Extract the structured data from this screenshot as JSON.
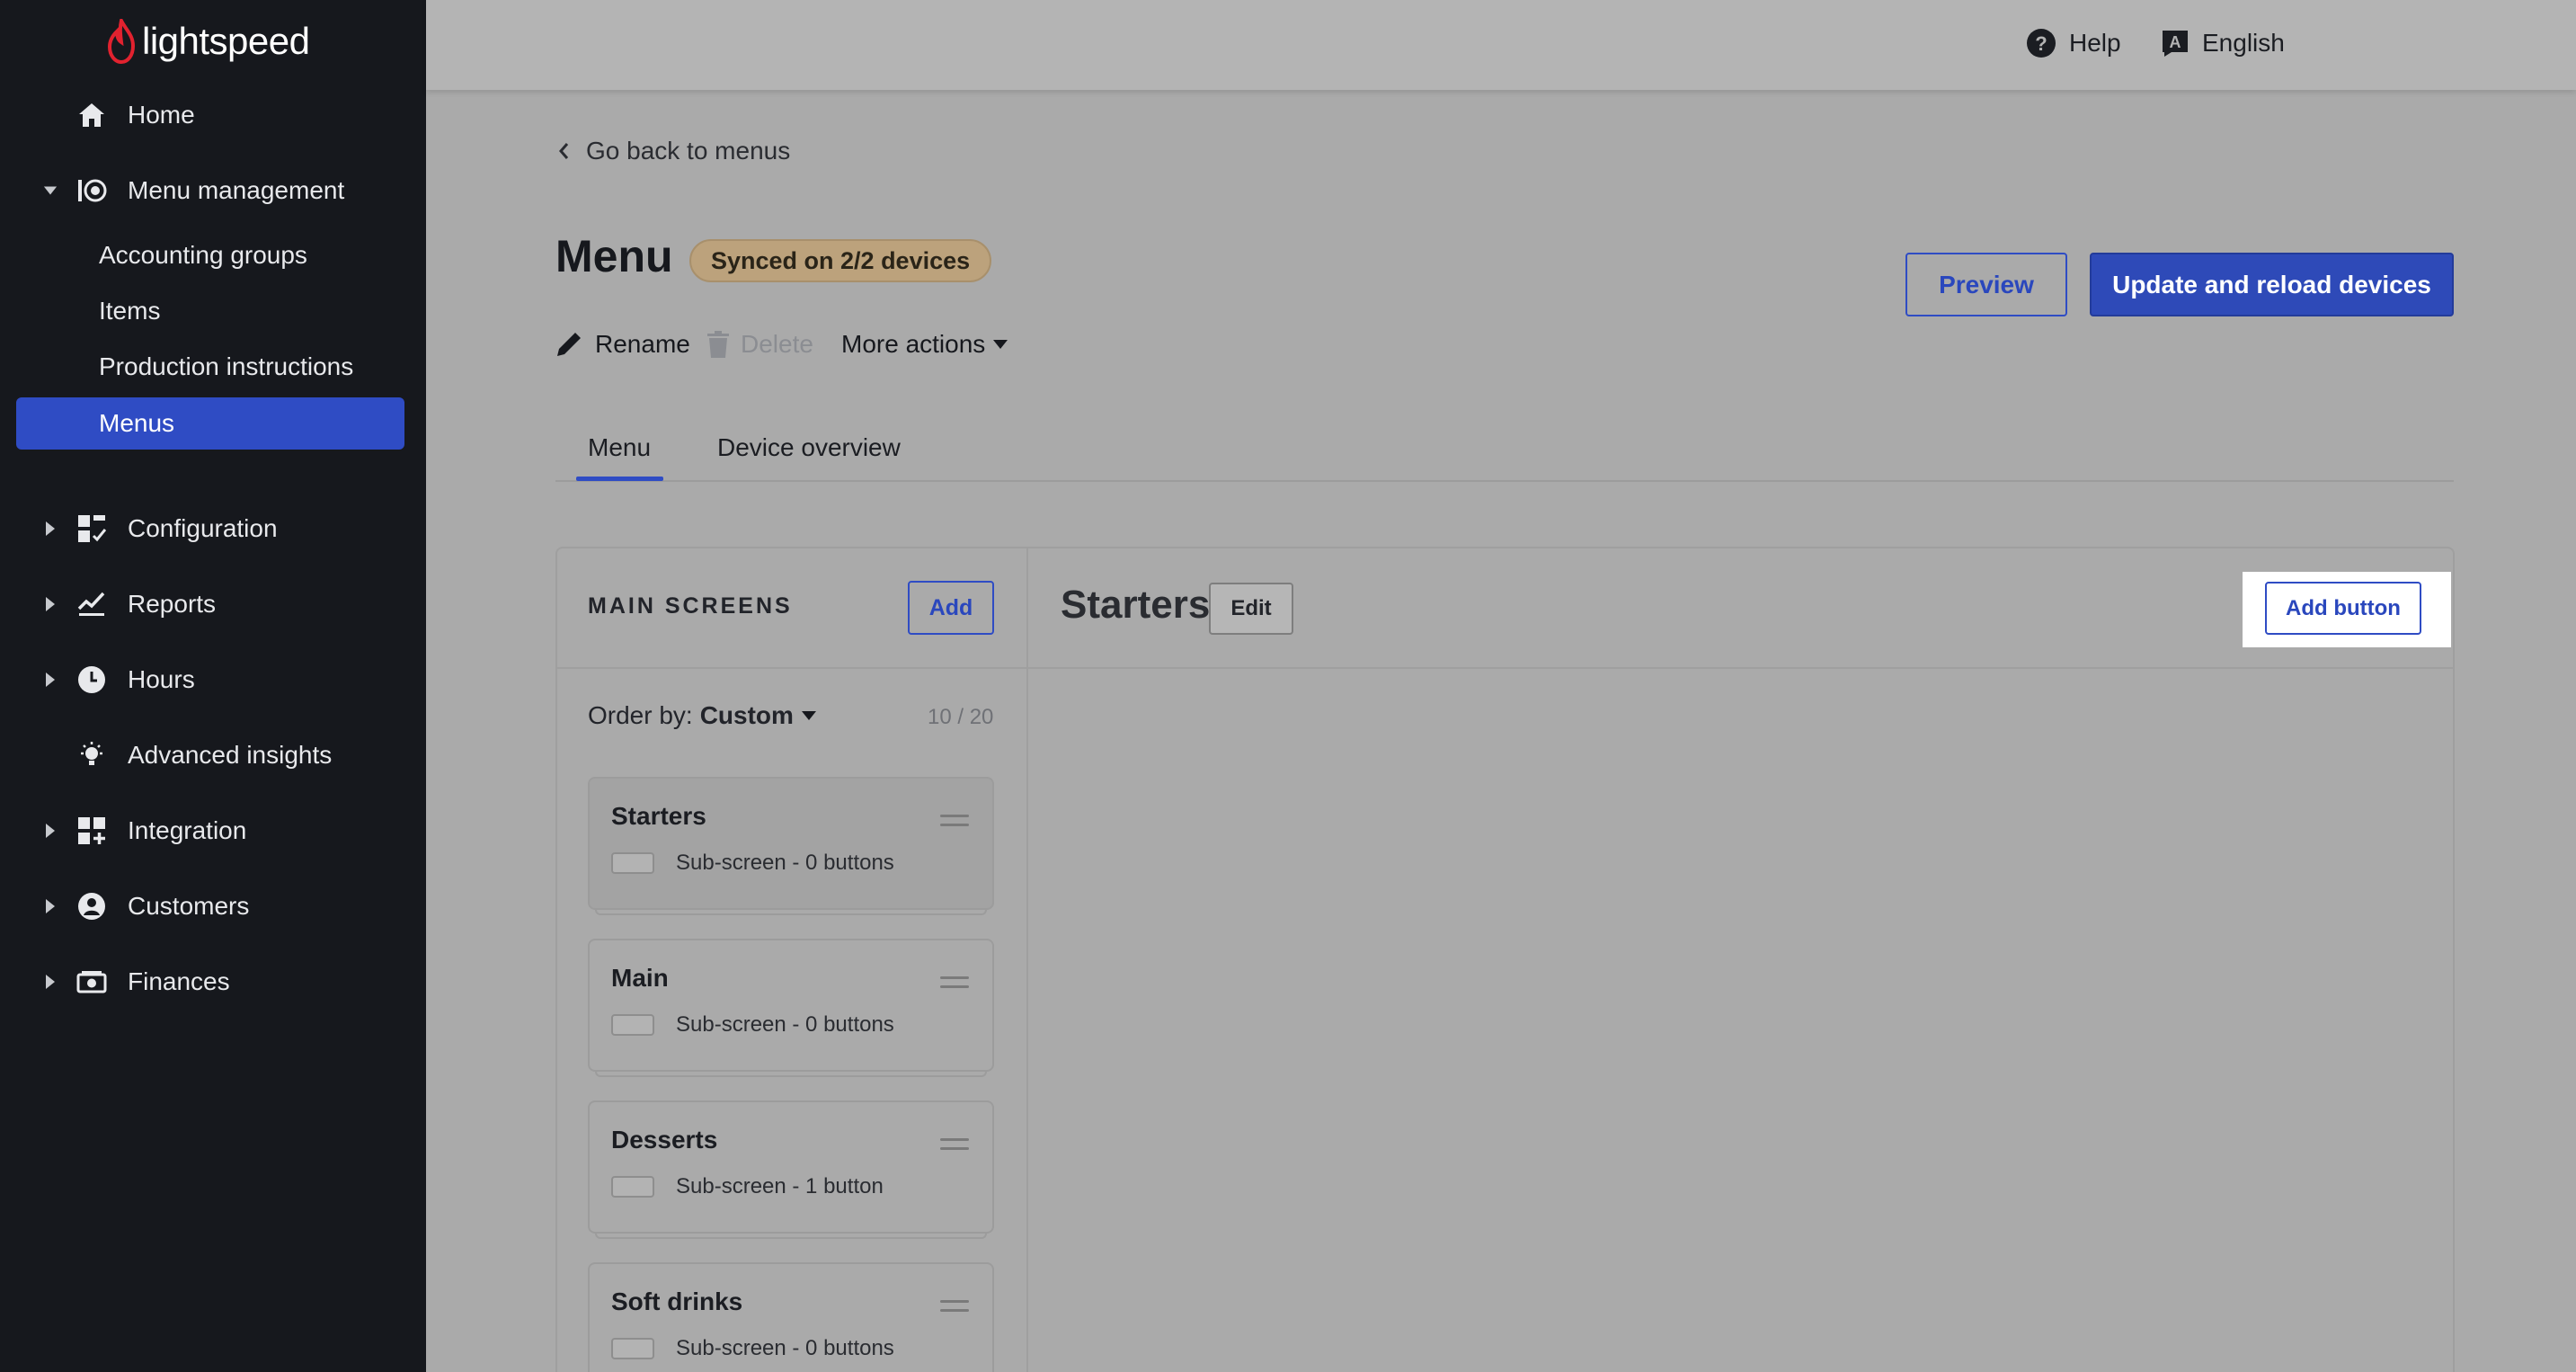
{
  "brand": {
    "name": "lightspeed"
  },
  "sidebar": {
    "items": [
      {
        "label": "Home",
        "icon": "home-icon"
      },
      {
        "label": "Menu management",
        "icon": "menu-management-icon"
      },
      {
        "label": "Configuration",
        "icon": "configuration-icon"
      },
      {
        "label": "Reports",
        "icon": "reports-icon"
      },
      {
        "label": "Hours",
        "icon": "clock-icon"
      },
      {
        "label": "Advanced insights",
        "icon": "lightbulb-icon"
      },
      {
        "label": "Integration",
        "icon": "integration-icon"
      },
      {
        "label": "Customers",
        "icon": "user-icon"
      },
      {
        "label": "Finances",
        "icon": "finances-icon"
      }
    ],
    "sub_items": [
      {
        "label": "Accounting groups"
      },
      {
        "label": "Items"
      },
      {
        "label": "Production instructions"
      },
      {
        "label": "Menus",
        "active": true
      }
    ]
  },
  "topbar": {
    "help": "Help",
    "language": "English"
  },
  "header": {
    "back_link": "Go back to menus",
    "title": "Menu",
    "sync_badge": "Synced on 2/2 devices",
    "preview_button": "Preview",
    "update_button": "Update and reload devices",
    "actions": {
      "rename": "Rename",
      "delete": "Delete",
      "more": "More actions"
    }
  },
  "tabs": [
    {
      "label": "Menu",
      "active": true
    },
    {
      "label": "Device overview"
    }
  ],
  "main_screens": {
    "heading": "MAIN SCREENS",
    "add_button": "Add",
    "order_by_label": "Order by:",
    "order_by_value": "Custom",
    "count": "10 / 20",
    "screens": [
      {
        "title": "Starters",
        "subtitle": "Sub-screen - 0 buttons",
        "selected": true
      },
      {
        "title": "Main",
        "subtitle": "Sub-screen - 0 buttons"
      },
      {
        "title": "Desserts",
        "subtitle": "Sub-screen - 1 button"
      },
      {
        "title": "Soft drinks",
        "subtitle": "Sub-screen - 0 buttons"
      }
    ]
  },
  "detail": {
    "title": "Starters",
    "edit_button": "Edit",
    "add_button": "Add button"
  },
  "colors": {
    "sidebar_bg": "#16181d",
    "accent": "#2f4cc4",
    "badge": "#bca27c",
    "logo_red": "#e2222f"
  }
}
